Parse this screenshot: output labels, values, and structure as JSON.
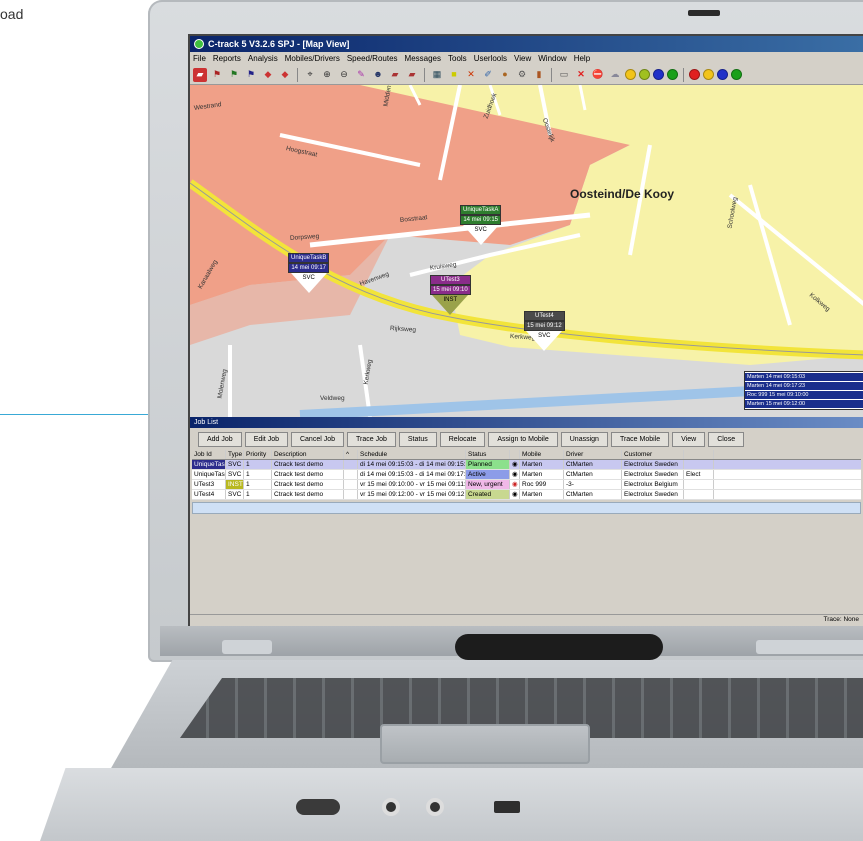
{
  "corner_text": "oad",
  "app": {
    "title": "C-track 5 V3.2.6 SPJ - [Map View]",
    "menu": [
      "File",
      "Reports",
      "Analysis",
      "Mobiles/Drivers",
      "Speed/Routes",
      "Messages",
      "Tools",
      "Userlools",
      "View",
      "Window",
      "Help"
    ],
    "toolbar_icons": [
      "truck-icon",
      "flag-icon",
      "flag-icon",
      "flag-icon",
      "car-icon",
      "car-icon",
      "route-icon",
      "zoom-in-icon",
      "zoom-out-icon",
      "pen-icon",
      "person-icon",
      "truck-icon",
      "truck-icon",
      "map-icon",
      "highlight-icon",
      "cross-icon",
      "pencil-icon",
      "pin-icon",
      "gear-icon",
      "bars-icon",
      "document-icon",
      "close-icon",
      "no-entry-icon",
      "cloud-icon",
      "status-icon",
      "status-icon",
      "status-icon",
      "status-icon"
    ],
    "status_colors": [
      "#e02020",
      "#f2c41a",
      "#2030c8",
      "#1aa01a"
    ]
  },
  "map": {
    "area_label": "Oosteind/De Kooy",
    "streets": [
      "Westrand",
      "Hoogstraat",
      "Middenweg",
      "Zuidhoek",
      "Oostelijk",
      "Bosstraat",
      "Dorpsweg",
      "Kanaalweg",
      "Havenweg",
      "Kruisweg",
      "Schoolweg",
      "Kolkweg",
      "Rijksweg",
      "Kerkweg",
      "Molenweg",
      "Kerkweg",
      "Veldweg"
    ],
    "markers": [
      {
        "label": "UniqueTaskA",
        "time": "14 mei 09:15",
        "code": "SVC",
        "color": "#2e7d2e"
      },
      {
        "label": "UniqueTaskB",
        "time": "14 mei 09:17",
        "code": "SVC",
        "color": "#2c2c8c"
      },
      {
        "label": "UTest3",
        "time": "15 mei 09:10",
        "code": "INST",
        "color": "#8a2c8a"
      },
      {
        "label": "UTest4",
        "time": "15 mei 09:12",
        "code": "SVC",
        "color": "#4a4a4a"
      }
    ],
    "popup_rows": [
      "Marten 14 mei 09:15:03",
      "Marten 14 mei 09:17:23",
      "Roc 999 15 mei 09:10:00",
      "Marten 15 mei 09:12:00"
    ]
  },
  "job_panel": {
    "title": "Job List",
    "buttons": [
      "Add Job",
      "Edit Job",
      "Cancel Job",
      "Trace Job",
      "Status",
      "Relocate",
      "Assign to Mobile",
      "Unassign",
      "Trace Mobile",
      "View",
      "Close"
    ],
    "columns": [
      "Job Id",
      "Type",
      "Priority",
      "Description",
      "^",
      "Schedule",
      "Status",
      "",
      "Mobile",
      "Driver",
      "Customer",
      ""
    ],
    "rows": [
      {
        "cells": [
          "UniqueTaskA",
          "SVC",
          "1",
          "Ctrack test demo",
          "",
          "di 14 mei 09:15:03 - di 14 mei 09:15:29",
          "Planned",
          "",
          "Marten",
          "CtMarten",
          "Electrolux Sweden",
          ""
        ],
        "status_color": "#8ce08c",
        "highlight": true
      },
      {
        "cells": [
          "UniqueTaskB",
          "SVC",
          "1",
          "Ctrack test demo",
          "",
          "di 14 mei 09:15:03 - di 14 mei 09:17:23",
          "Active",
          "",
          "Marten",
          "CtMarten",
          "Electrolux Sweden",
          "Elect"
        ],
        "status_color": "#8c9ce8",
        "highlight": false
      },
      {
        "cells": [
          "UTest3",
          "INST",
          "1",
          "Ctrack test demo",
          "",
          "vr 15 mei 09:10:00 - vr 15 mei 09:11:29",
          "New, urgent",
          "",
          "Roc 999",
          "-3-",
          "Electrolux Belgium",
          ""
        ],
        "status_color": "#f0b8e8",
        "highlight": false
      },
      {
        "cells": [
          "UTest4",
          "SVC",
          "1",
          "Ctrack test demo",
          "",
          "vr 15 mei 09:12:00 - vr 15 mei 09:12:29",
          "Created",
          "",
          "Marten",
          "CtMarten",
          "Electrolux Sweden",
          ""
        ],
        "status_color": "#c8d890",
        "highlight": false
      }
    ]
  },
  "statusbar": {
    "right": "Trace: None"
  }
}
